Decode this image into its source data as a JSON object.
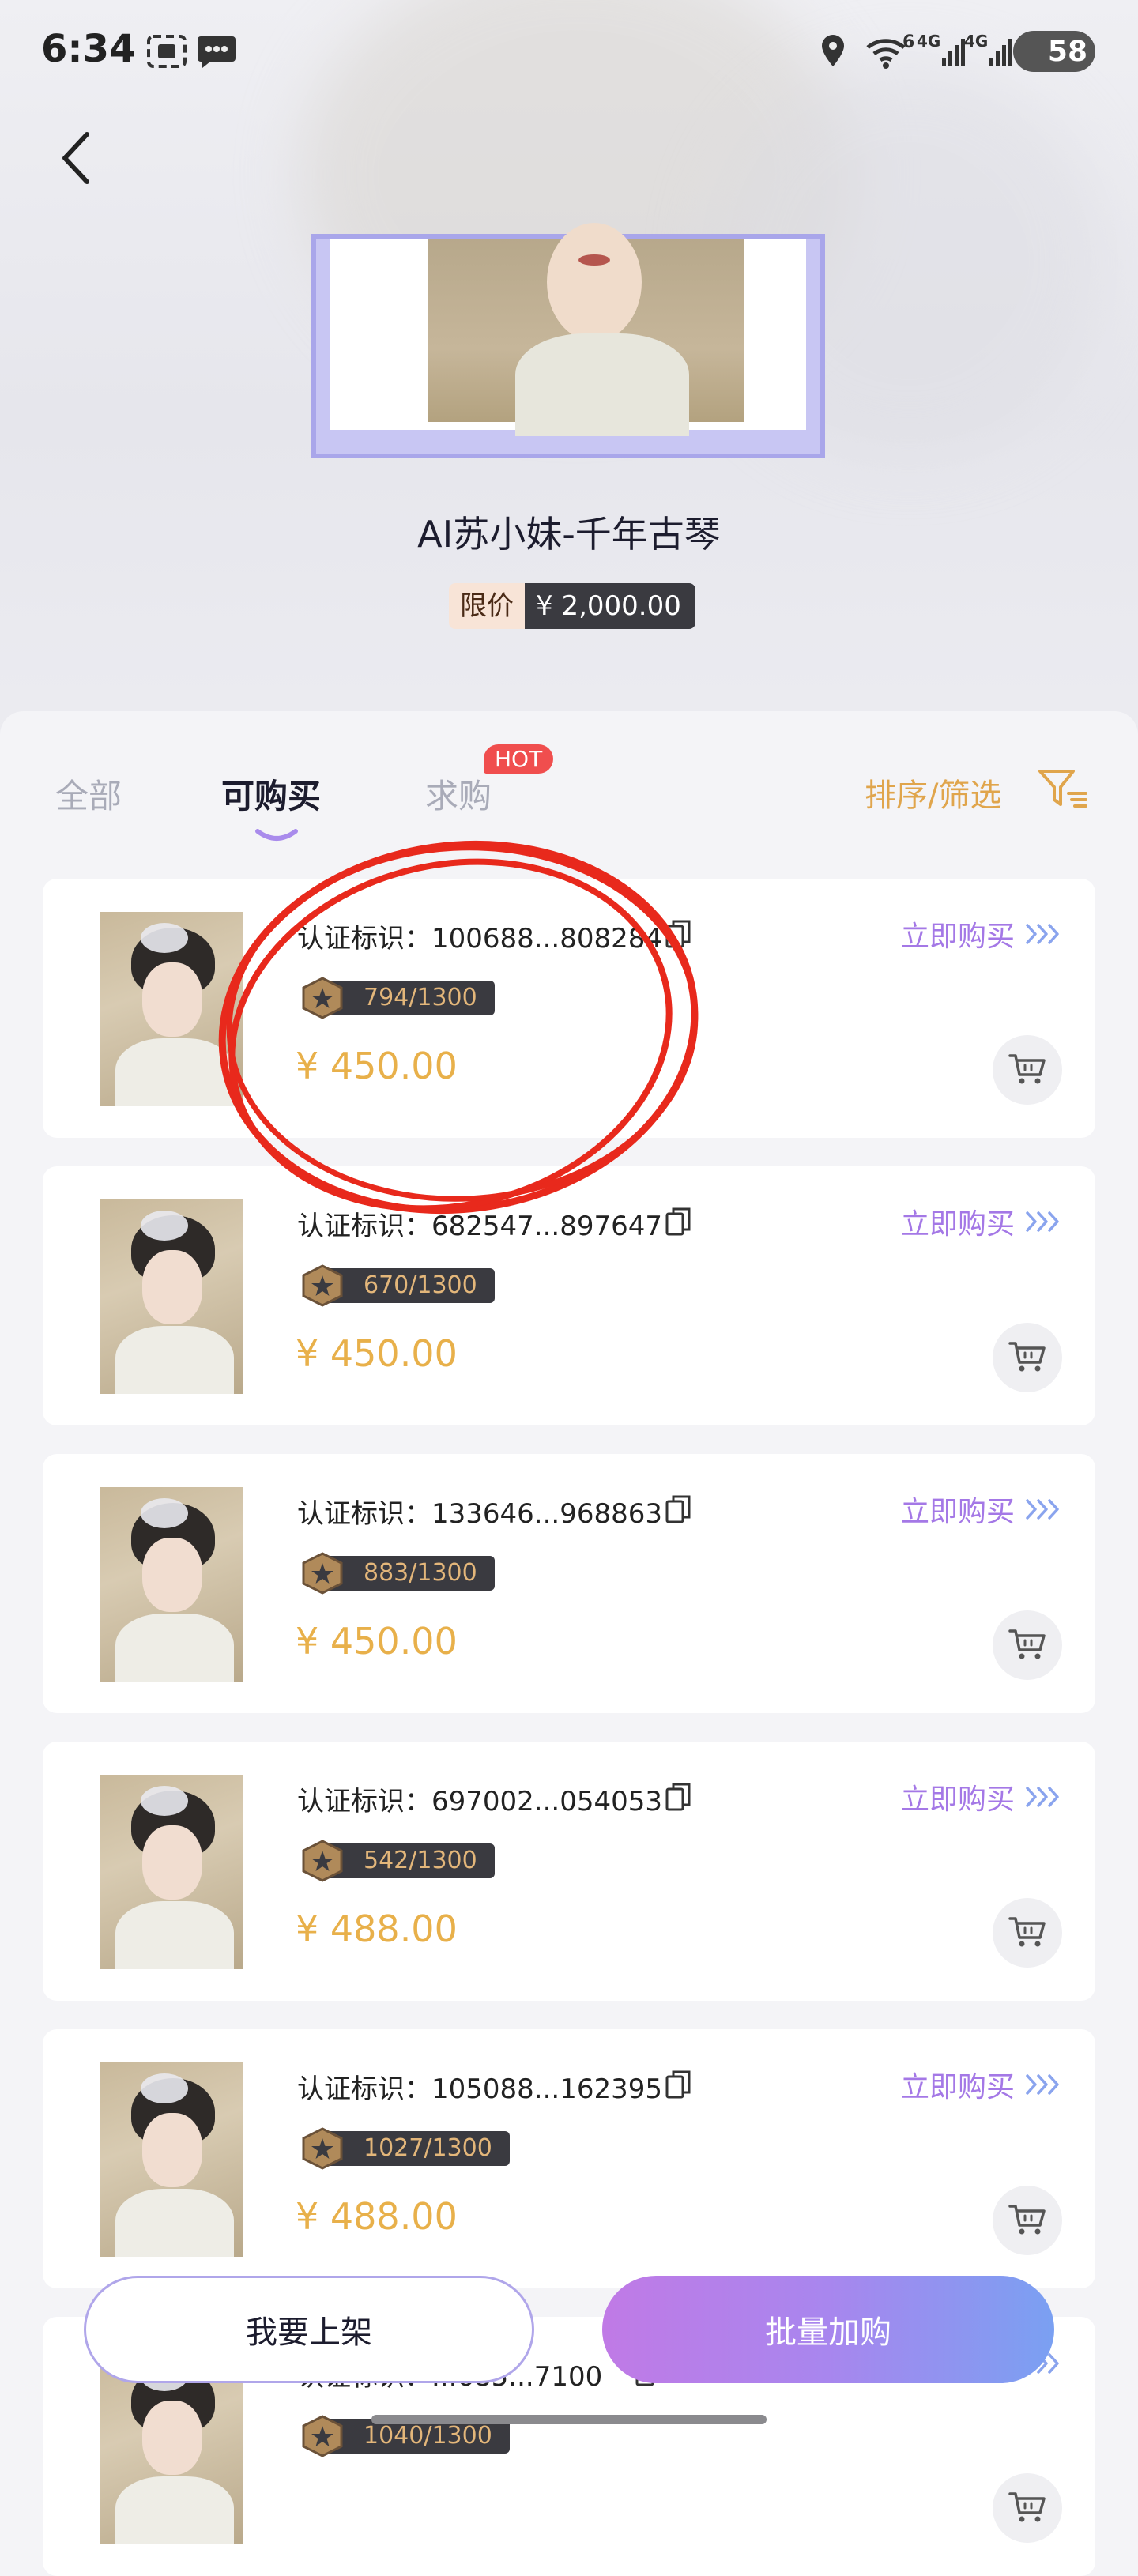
{
  "status_bar": {
    "time": "6:34",
    "battery": "58",
    "network_1": "4G",
    "network_2": "4G",
    "wifi_badge": "6"
  },
  "product": {
    "title": "AI苏小妹-千年古琴",
    "price_label": "限价",
    "price_value": "¥ 2,000.00"
  },
  "tabs": [
    {
      "label": "全部",
      "active": false
    },
    {
      "label": "可购买",
      "active": true
    },
    {
      "label": "求购",
      "active": false,
      "badge": "HOT"
    }
  ],
  "sort_label": "排序/筛选",
  "colors": {
    "accent_purple": "#a478e6",
    "price_gold": "#e8b04a",
    "hot_red": "#f04e4e",
    "badge_dark": "#3a3a40"
  },
  "listings": [
    {
      "cert_prefix": "认证标识：",
      "cert_id": "100688...808284",
      "serial": "794/1300",
      "price": "¥ 450.00",
      "buy_label": "立即购买"
    },
    {
      "cert_prefix": "认证标识：",
      "cert_id": "682547...897647",
      "serial": "670/1300",
      "price": "¥ 450.00",
      "buy_label": "立即购买"
    },
    {
      "cert_prefix": "认证标识：",
      "cert_id": "133646...968863",
      "serial": "883/1300",
      "price": "¥ 450.00",
      "buy_label": "立即购买"
    },
    {
      "cert_prefix": "认证标识：",
      "cert_id": "697002...054053",
      "serial": "542/1300",
      "price": "¥ 488.00",
      "buy_label": "立即购买"
    },
    {
      "cert_prefix": "认证标识：",
      "cert_id": "105088...162395",
      "serial": "1027/1300",
      "price": "¥ 488.00",
      "buy_label": "立即购买"
    },
    {
      "cert_prefix": "认证标识：",
      "cert_id": "...685...7100",
      "serial": "1040/1300",
      "price": "",
      "buy_label": ""
    }
  ],
  "actions": {
    "list_label": "我要上架",
    "batch_label": "批量加购"
  }
}
